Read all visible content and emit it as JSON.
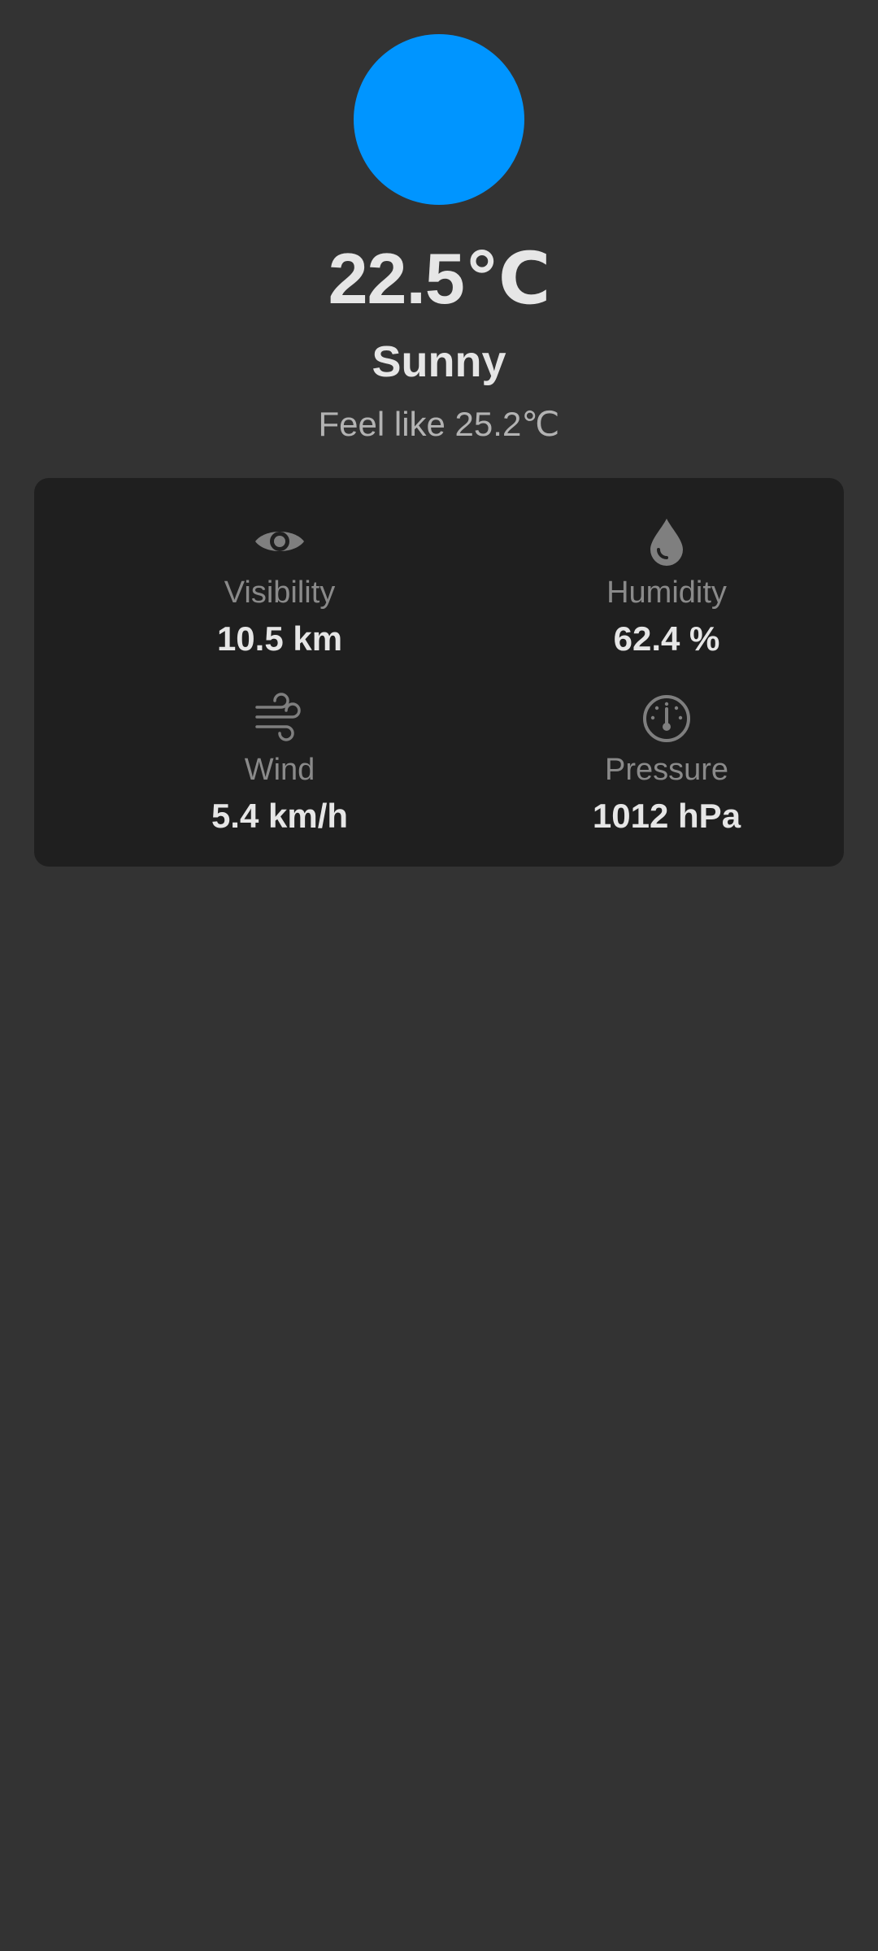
{
  "current": {
    "icon": "sun-icon",
    "temperature": "22.5℃",
    "condition": "Sunny",
    "feels_like": "Feel like 25.2℃"
  },
  "details": {
    "visibility": {
      "icon": "eye-icon",
      "label": "Visibility",
      "value": "10.5 km"
    },
    "humidity": {
      "icon": "water-drop-icon",
      "label": "Humidity",
      "value": "62.4 %"
    },
    "wind": {
      "icon": "wind-icon",
      "label": "Wind",
      "value": "5.4 km/h"
    },
    "pressure": {
      "icon": "gauge-icon",
      "label": "Pressure",
      "value": "1012 hPa"
    }
  },
  "colors": {
    "background": "#333333",
    "card": "#1f1f1f",
    "accent": "#0095ff",
    "primary_text": "#e6e6e6",
    "secondary_text": "#8a8a8a",
    "icon": "#7f7f7f"
  }
}
